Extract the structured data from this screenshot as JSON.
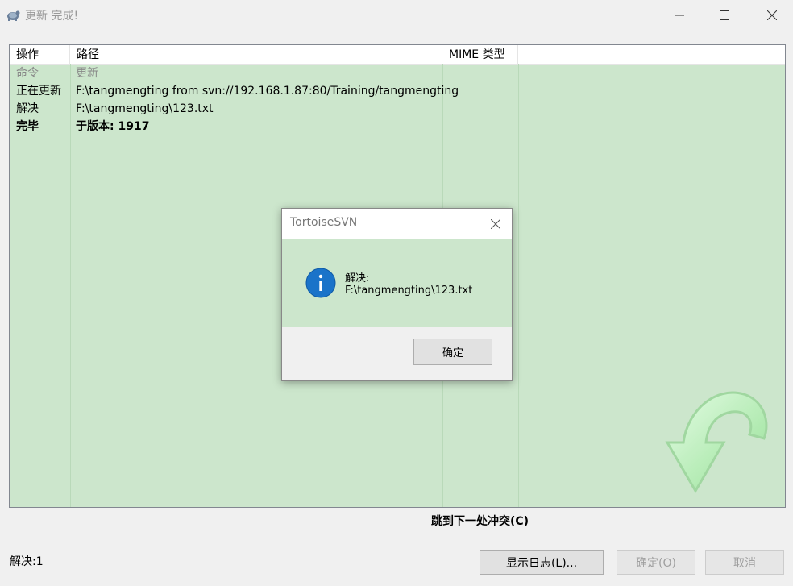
{
  "window": {
    "title": "更新 完成!",
    "icon": "tortoise-icon",
    "controls": [
      "minimize-icon",
      "maximize-icon",
      "close-icon"
    ]
  },
  "list": {
    "columns": [
      "操作",
      "路径",
      "MIME 类型",
      ""
    ],
    "rows": [
      {
        "action": "命令",
        "path": "更新",
        "mime": "",
        "style": "dim"
      },
      {
        "action": "正在更新",
        "path": "F:\\tangmengting from svn://192.168.1.87:80/Training/tangmengting",
        "mime": "",
        "style": "normal"
      },
      {
        "action": "解决",
        "path": "F:\\tangmengting\\123.txt",
        "mime": "",
        "style": "normal"
      },
      {
        "action": "完毕",
        "path": "于版本: 1917",
        "mime": "",
        "style": "bold"
      }
    ],
    "background_color": "#cce6cc"
  },
  "dialog": {
    "title": "TortoiseSVN",
    "icon": "info-icon",
    "message_line1": "解决:",
    "message_line2": "F:\\tangmengting\\123.txt",
    "ok_label": "确定"
  },
  "next_conflict_label": "跳到下一处冲突(C)",
  "status_text": "解决:1",
  "buttons": {
    "show_log": "显示日志(L)...",
    "ok": "确定(O)",
    "cancel": "取消"
  }
}
